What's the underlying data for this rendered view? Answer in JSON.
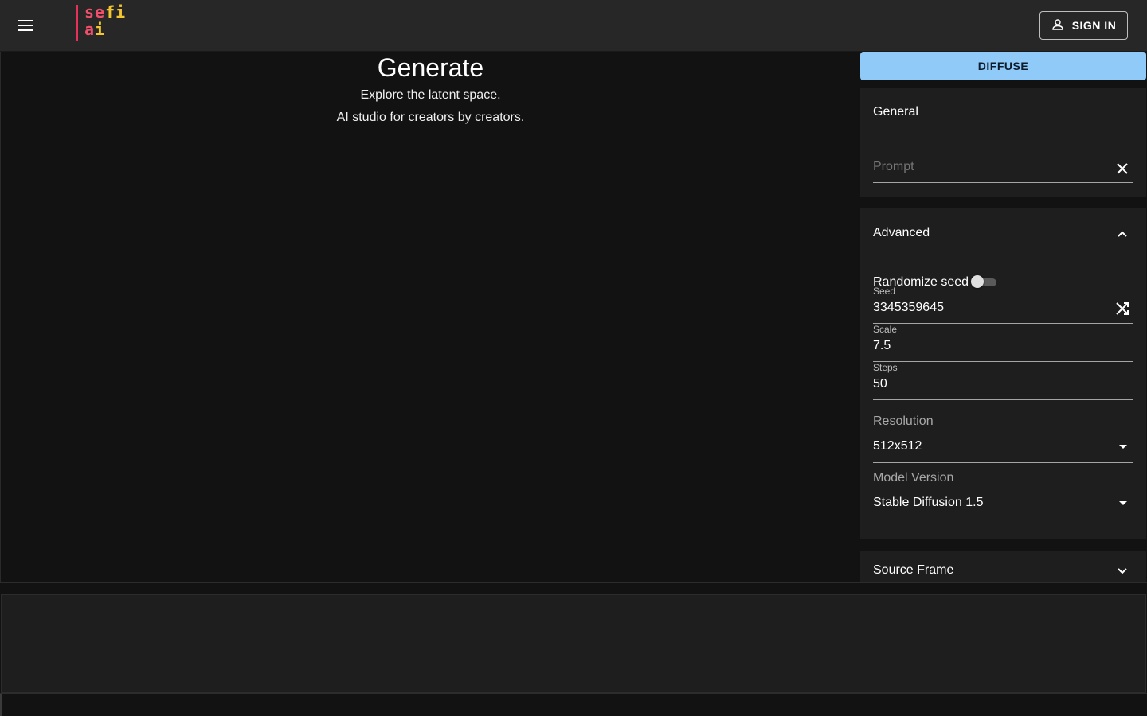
{
  "header": {
    "menu_icon": "hamburger-menu-icon",
    "logo": {
      "line1_a": "se",
      "line1_b": "fi",
      "line2_a": "a",
      "line2_b": "i"
    },
    "signin_label": "SIGN IN",
    "signin_icon": "person-outline-icon"
  },
  "main": {
    "title": "Generate",
    "subtitle1": "Explore the latent space.",
    "subtitle2": "AI studio for creators by creators."
  },
  "panel": {
    "diffuse_label": "DIFFUSE",
    "general": {
      "title": "General",
      "prompt_placeholder": "Prompt",
      "prompt_value": "",
      "clear_icon": "close-icon"
    },
    "advanced": {
      "title": "Advanced",
      "expanded": true,
      "randomize_seed_label": "Randomize seed",
      "randomize_seed_on": false,
      "seed_label": "Seed",
      "seed_value": "3345359645",
      "shuffle_icon": "shuffle-icon",
      "scale_label": "Scale",
      "scale_value": "7.5",
      "steps_label": "Steps",
      "steps_value": "50",
      "resolution_label": "Resolution",
      "resolution_value": "512x512",
      "model_label": "Model Version",
      "model_value": "Stable Diffusion 1.5"
    },
    "source_frame": {
      "title": "Source Frame",
      "expanded": false
    }
  },
  "colors": {
    "accent": "#90caf9",
    "background": "#121212",
    "surface": "#1e1e1e",
    "appbar": "#272727",
    "logo_pink": "#ef4f6a",
    "logo_yellow": "#f3c630"
  }
}
